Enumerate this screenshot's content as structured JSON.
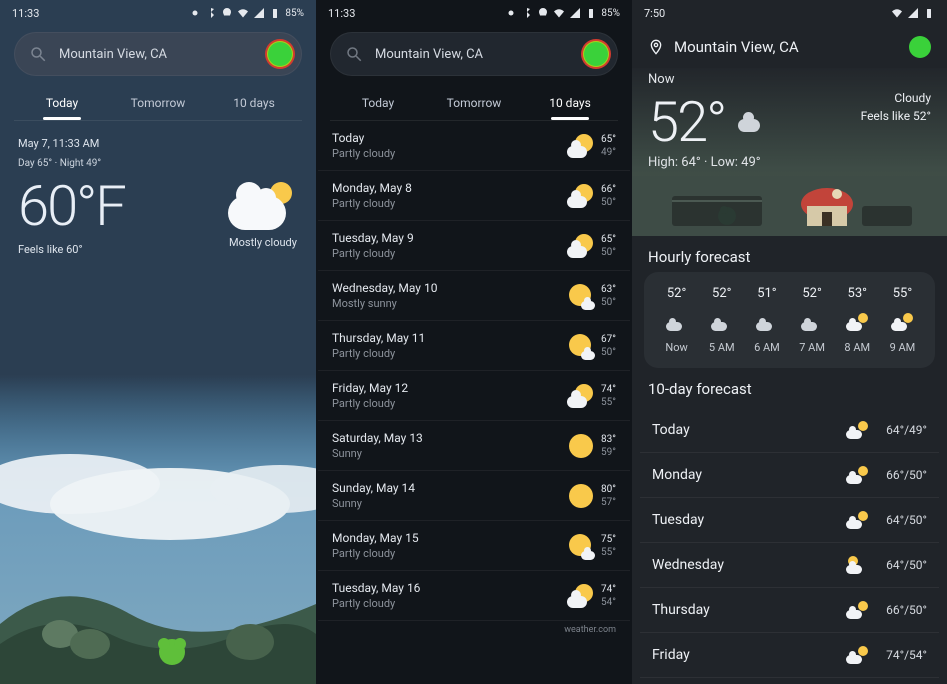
{
  "status": {
    "time_a": "11:33",
    "time_b": "11:33",
    "time_c": "7:50",
    "battery": "85%"
  },
  "search": {
    "location": "Mountain View, CA"
  },
  "tabs": {
    "today": "Today",
    "tomorrow": "Tomorrow",
    "tenday": "10 days"
  },
  "left": {
    "timestamp": "May 7, 11:33 AM",
    "daynight": "Day 65° · Night 49°",
    "temp": "60°F",
    "feels": "Feels like 60°",
    "cond": "Mostly cloudy"
  },
  "middle": {
    "credit": "weather.com",
    "days": [
      {
        "name": "Today",
        "cond": "Partly cloudy",
        "icon": "pc",
        "hi": "65°",
        "lo": "49°"
      },
      {
        "name": "Monday, May 8",
        "cond": "Partly cloudy",
        "icon": "pc",
        "hi": "66°",
        "lo": "50°"
      },
      {
        "name": "Tuesday, May 9",
        "cond": "Partly cloudy",
        "icon": "pc",
        "hi": "65°",
        "lo": "50°"
      },
      {
        "name": "Wednesday, May 10",
        "cond": "Mostly sunny",
        "icon": "ms",
        "hi": "63°",
        "lo": "50°"
      },
      {
        "name": "Thursday, May 11",
        "cond": "Partly cloudy",
        "icon": "ms",
        "hi": "67°",
        "lo": "50°"
      },
      {
        "name": "Friday, May 12",
        "cond": "Partly cloudy",
        "icon": "pc",
        "hi": "74°",
        "lo": "55°"
      },
      {
        "name": "Saturday, May 13",
        "cond": "Sunny",
        "icon": "su",
        "hi": "83°",
        "lo": "59°"
      },
      {
        "name": "Sunday, May 14",
        "cond": "Sunny",
        "icon": "su",
        "hi": "80°",
        "lo": "57°"
      },
      {
        "name": "Monday, May 15",
        "cond": "Partly cloudy",
        "icon": "ms",
        "hi": "75°",
        "lo": "55°"
      },
      {
        "name": "Tuesday, May 16",
        "cond": "Partly cloudy",
        "icon": "pc",
        "hi": "74°",
        "lo": "54°"
      }
    ]
  },
  "right": {
    "nowlabel": "Now",
    "temp": "52°",
    "cond": "Cloudy",
    "feels": "Feels like 52°",
    "hilo": "High: 64° · Low: 49°",
    "hourly_title": "Hourly forecast",
    "tenday_title": "10-day forecast",
    "hourly": [
      {
        "t": "52°",
        "l": "Now",
        "icon": "cl"
      },
      {
        "t": "52°",
        "l": "5 AM",
        "icon": "cl"
      },
      {
        "t": "51°",
        "l": "6 AM",
        "icon": "cl"
      },
      {
        "t": "52°",
        "l": "7 AM",
        "icon": "cl"
      },
      {
        "t": "53°",
        "l": "8 AM",
        "icon": "pc"
      },
      {
        "t": "55°",
        "l": "9 AM",
        "icon": "pc"
      }
    ],
    "days": [
      {
        "name": "Today",
        "icon": "pc",
        "hl": "64°/49°"
      },
      {
        "name": "Monday",
        "icon": "pc",
        "hl": "66°/50°"
      },
      {
        "name": "Tuesday",
        "icon": "pc",
        "hl": "64°/50°"
      },
      {
        "name": "Wednesday",
        "icon": "ms",
        "hl": "64°/50°"
      },
      {
        "name": "Thursday",
        "icon": "pc",
        "hl": "66°/50°"
      },
      {
        "name": "Friday",
        "icon": "pc",
        "hl": "74°/54°"
      }
    ]
  }
}
